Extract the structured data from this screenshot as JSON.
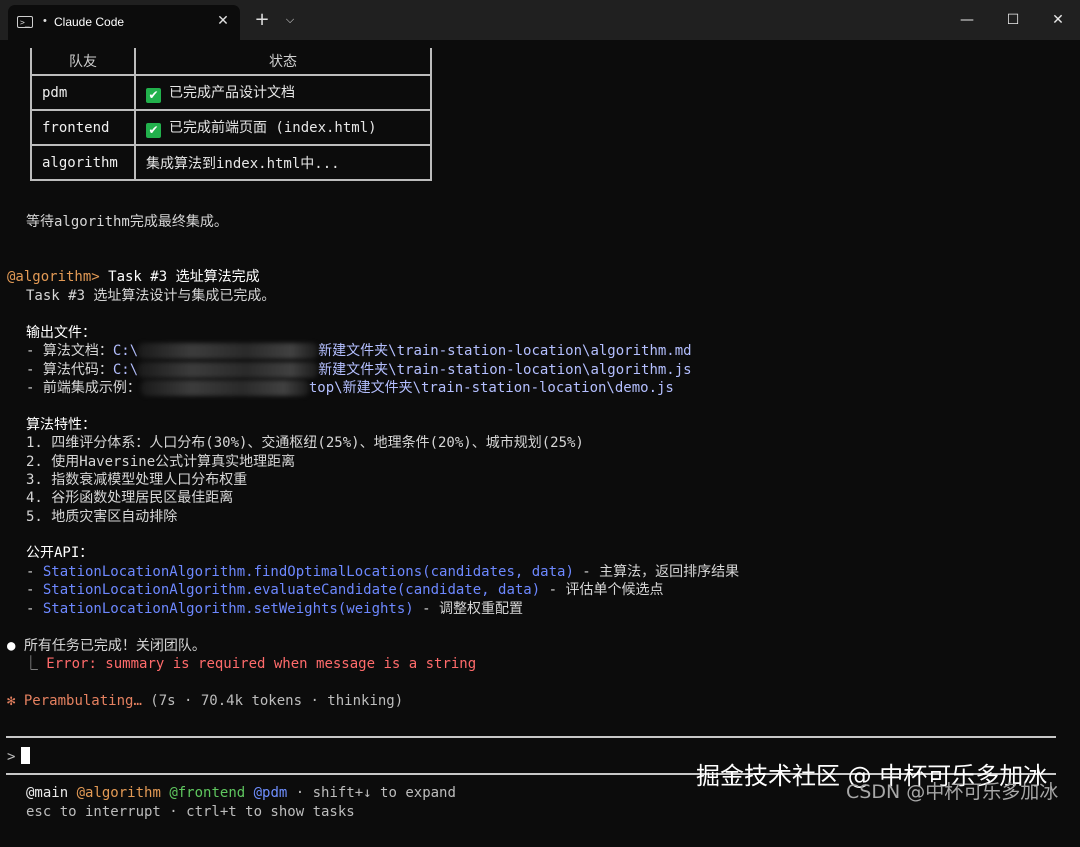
{
  "window": {
    "tab_title": "Claude Code",
    "tab_dot": "•",
    "tab_icon_glyph": ">_",
    "tab_close": "✕",
    "new_tab": "+",
    "tab_menu": "⌵",
    "minimize": "—",
    "maximize": "☐",
    "close": "✕"
  },
  "table": {
    "headers": [
      "队友",
      "状态"
    ],
    "rows": [
      {
        "name": "pdm",
        "status": "已完成产品设计文档",
        "done": true
      },
      {
        "name": "frontend",
        "status": "已完成前端页面 (index.html)",
        "done": true
      },
      {
        "name": "algorithm",
        "status": "集成算法到index.html中...",
        "done": false
      }
    ]
  },
  "wait_line": "等待algorithm完成最终集成。",
  "message": {
    "sender": "@algorithm>",
    "subject": " Task #3 选址算法完成",
    "body": "Task #3 选址算法设计与集成已完成。"
  },
  "output_files": {
    "title": "输出文件：",
    "items": [
      {
        "prefix": "- 算法文档：",
        "start": "C:\\",
        "end": "新建文件夹\\train-station-location\\algorithm.md"
      },
      {
        "prefix": "- 算法代码：",
        "start": "C:\\",
        "end": "新建文件夹\\train-station-location\\algorithm.js"
      },
      {
        "prefix": "- 前端集成示例：",
        "start": "",
        "end": "top\\新建文件夹\\train-station-location\\demo.js"
      }
    ]
  },
  "features": {
    "title": "算法特性：",
    "items": [
      "1. 四维评分体系：人口分布(30%)、交通枢纽(25%)、地理条件(20%)、城市规划(25%)",
      "2. 使用Haversine公式计算真实地理距离",
      "3. 指数衰减模型处理人口分布权重",
      "4. 谷形函数处理居民区最佳距离",
      "5. 地质灾害区自动排除"
    ]
  },
  "api": {
    "title": "公开API：",
    "items": [
      {
        "prefix": "- ",
        "code": "StationLocationAlgorithm.findOptimalLocations(candidates, data)",
        "desc": " - 主算法，返回排序结果"
      },
      {
        "prefix": "- ",
        "code": "StationLocationAlgorithm.evaluateCandidate(candidate, data)",
        "desc": " - 评估单个候选点"
      },
      {
        "prefix": "- ",
        "code": "StationLocationAlgorithm.setWeights(weights)",
        "desc": " - 调整权重配置"
      }
    ]
  },
  "done_line": {
    "bullet": "●",
    "text": " 所有任务已完成！关闭团队。"
  },
  "error_line": {
    "branch": "  ⎿ ",
    "text": "Error: summary is required when message is a string"
  },
  "status_line": {
    "spinner": "✻",
    "verb": " Perambulating…",
    "meta": " (7s · 70.4k tokens · thinking)"
  },
  "prompt": {
    "symbol": ">"
  },
  "footer": {
    "agents": [
      {
        "label": "@main",
        "color": "#e8e8e8"
      },
      {
        "label": "@algorithm",
        "color": "#e39a55"
      },
      {
        "label": "@frontend",
        "color": "#5fc75f"
      },
      {
        "label": "@pdm",
        "color": "#6f8fff"
      }
    ],
    "expand_hint": " · shift+↓ to expand",
    "shortcuts": "esc to interrupt · ctrl+t to show tasks"
  },
  "watermark": {
    "line1": "掘金技术社区 @ 中杯可乐多加冰",
    "line2": "CSDN @中杯可乐多加冰"
  }
}
